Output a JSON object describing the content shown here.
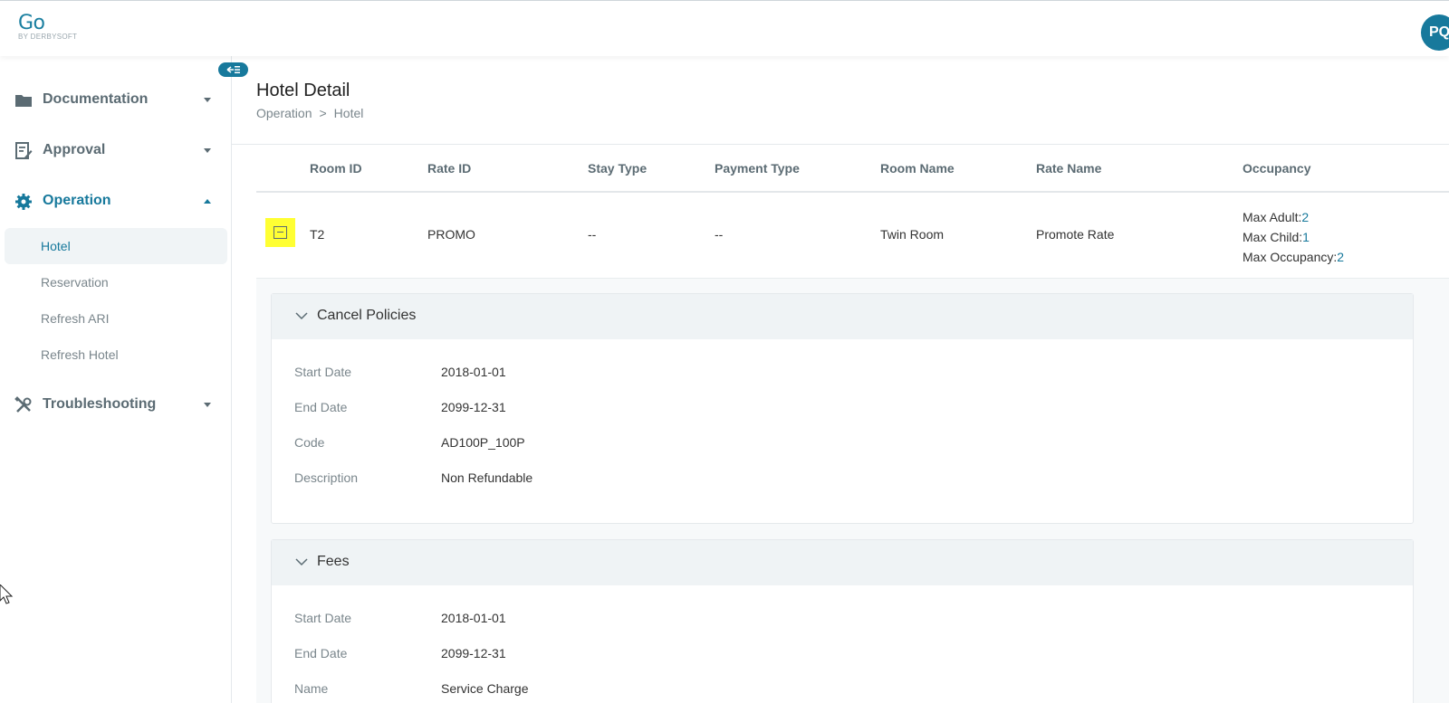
{
  "header": {
    "logo_main": "Go",
    "logo_sub": "BY DERBYSOFT",
    "avatar_initials": "PQ"
  },
  "sidebar": {
    "groups": [
      {
        "label": "Documentation",
        "icon": "folder-icon",
        "expanded": false
      },
      {
        "label": "Approval",
        "icon": "approval-icon",
        "expanded": false
      },
      {
        "label": "Operation",
        "icon": "gear-icon",
        "expanded": true
      },
      {
        "label": "Troubleshooting",
        "icon": "tools-icon",
        "expanded": false
      }
    ],
    "operation_items": [
      {
        "label": "Hotel",
        "active": true
      },
      {
        "label": "Reservation",
        "active": false
      },
      {
        "label": "Refresh ARI",
        "active": false
      },
      {
        "label": "Refresh Hotel",
        "active": false
      }
    ]
  },
  "page": {
    "title": "Hotel Detail",
    "breadcrumb": [
      "Operation",
      "Hotel"
    ],
    "breadcrumb_sep": ">"
  },
  "table": {
    "columns": [
      "Room ID",
      "Rate ID",
      "Stay Type",
      "Payment Type",
      "Room Name",
      "Rate Name",
      "Occupancy"
    ],
    "row": {
      "room_id": "T2",
      "rate_id": "PROMO",
      "stay_type": "--",
      "payment_type": "--",
      "room_name": "Twin Room",
      "rate_name": "Promote Rate",
      "occupancy": {
        "max_adult_label": "Max Adult:",
        "max_adult": "2",
        "max_child_label": "Max Child:",
        "max_child": "1",
        "max_occupancy_label": "Max Occupancy:",
        "max_occupancy": "2"
      }
    }
  },
  "cancel_policies": {
    "title": "Cancel Policies",
    "fields": [
      {
        "key": "Start Date",
        "value": "2018-01-01"
      },
      {
        "key": "End Date",
        "value": "2099-12-31"
      },
      {
        "key": "Code",
        "value": "AD100P_100P"
      },
      {
        "key": "Description",
        "value": "Non Refundable"
      }
    ]
  },
  "fees": {
    "title": "Fees",
    "fields": [
      {
        "key": "Start Date",
        "value": "2018-01-01"
      },
      {
        "key": "End Date",
        "value": "2099-12-31"
      },
      {
        "key": "Name",
        "value": "Service Charge"
      }
    ]
  },
  "colors": {
    "accent": "#17799c",
    "highlight": "#ffff33"
  }
}
